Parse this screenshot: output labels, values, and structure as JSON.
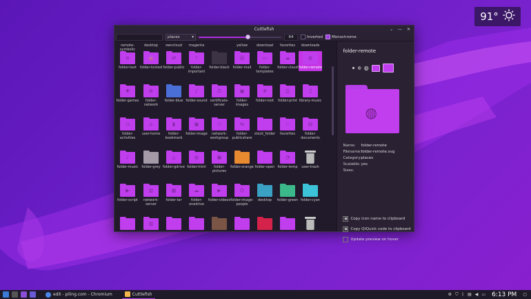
{
  "weather": {
    "temperature": "91°",
    "icon": "sun-icon"
  },
  "window": {
    "title": "Cuttlefish",
    "buttons": [
      "⌄",
      "—",
      "✕"
    ]
  },
  "toolbar": {
    "search_value": "",
    "category": "places",
    "size_value": "64",
    "size_fraction": 0.6,
    "inverted_label": "Inverted",
    "inverted_checked": false,
    "monochrome_label": "Monochrome",
    "monochrome_checked": true
  },
  "top_labels": [
    "remote-symbolic",
    "desktop",
    "owncloud",
    "magenta",
    "",
    "yellow",
    "download",
    "favorites",
    "downloads"
  ],
  "rows": [
    [
      {
        "label": "folder-text",
        "color": "#c03eee",
        "glyph": "≡"
      },
      {
        "label": "folder-locked",
        "color": "#c03eee",
        "glyph": "🔒"
      },
      {
        "label": "folder-public",
        "color": "#c03eee",
        "glyph": "⇄"
      },
      {
        "label": "folder-important",
        "color": "#c03eee",
        "glyph": "!"
      },
      {
        "label": "folder-black",
        "color": "#3c3444",
        "glyph": ""
      },
      {
        "label": "folder-mail",
        "color": "#c03eee",
        "glyph": "@"
      },
      {
        "label": "folder-templates",
        "color": "#c03eee",
        "glyph": "▭"
      },
      {
        "label": "folder-cloud",
        "color": "#c03eee",
        "glyph": "☁"
      },
      {
        "label": "folder-remote",
        "color": "#c03eee",
        "glyph": "◍",
        "selected": true
      }
    ],
    [
      {
        "label": "folder-games",
        "color": "#c03eee",
        "glyph": "✚"
      },
      {
        "label": "folder-network",
        "color": "#c03eee",
        "glyph": "⊞"
      },
      {
        "label": "folder-blue",
        "color": "#4a6fd6",
        "glyph": ""
      },
      {
        "label": "folder-sound",
        "color": "#c03eee",
        "glyph": "♪"
      },
      {
        "label": "certificate-server",
        "color": "#c03eee",
        "glyph": "⚿"
      },
      {
        "label": "folder-images",
        "color": "#c03eee",
        "glyph": "▣"
      },
      {
        "label": "folder-root",
        "color": "#c03eee",
        "glyph": "#"
      },
      {
        "label": "folder-print",
        "color": "#c03eee",
        "glyph": "⎙"
      },
      {
        "label": "library-music",
        "color": "#c03eee",
        "glyph": "♫"
      }
    ],
    [
      {
        "label": "folder-activities",
        "color": "#c03eee",
        "glyph": "◷"
      },
      {
        "label": "user-home",
        "color": "#c03eee",
        "glyph": "⌂"
      },
      {
        "label": "folder-bookmark",
        "color": "#c03eee",
        "glyph": "▮"
      },
      {
        "label": "folder-image",
        "color": "#c03eee",
        "glyph": "▣"
      },
      {
        "label": "network-workgroup",
        "color": "#c03eee",
        "glyph": "⚇"
      },
      {
        "label": "folder-publicshare",
        "color": "#c03eee",
        "glyph": "⇆"
      },
      {
        "label": "stock_folder",
        "color": "#c03eee",
        "glyph": ""
      },
      {
        "label": "favorites",
        "color": "#c03eee",
        "glyph": "☆"
      },
      {
        "label": "folder-documents",
        "color": "#c03eee",
        "glyph": "▤"
      }
    ],
    [
      {
        "label": "folder-music",
        "color": "#c03eee",
        "glyph": "♪"
      },
      {
        "label": "folder-grey",
        "color": "#a49aa8",
        "glyph": ""
      },
      {
        "label": "folder-gdrive",
        "color": "#c03eee",
        "glyph": "△"
      },
      {
        "label": "folder-html",
        "color": "#c03eee",
        "glyph": "◍"
      },
      {
        "label": "folder-pictures",
        "color": "#c03eee",
        "glyph": "▣"
      },
      {
        "label": "folder-orange",
        "color": "#e88a2f",
        "glyph": ""
      },
      {
        "label": "folder-open",
        "color": "#c03eee",
        "glyph": ""
      },
      {
        "label": "folder-temp",
        "color": "#c03eee",
        "glyph": "◔"
      },
      {
        "label": "user-trash",
        "color": "",
        "glyph": "",
        "trash": true
      }
    ],
    [
      {
        "label": "folder-script",
        "color": "#c03eee",
        "glyph": "▶"
      },
      {
        "label": "network-server",
        "color": "#c03eee",
        "glyph": "▥"
      },
      {
        "label": "folder-tar",
        "color": "#c03eee",
        "glyph": "▦"
      },
      {
        "label": "folder-onedrive",
        "color": "#c03eee",
        "glyph": "☁"
      },
      {
        "label": "folder-videos",
        "color": "#c03eee",
        "glyph": "▶"
      },
      {
        "label": "folder-image-people",
        "color": "#c03eee",
        "glyph": "☺"
      },
      {
        "label": "desktop",
        "color": "#3aa0c4",
        "glyph": ""
      },
      {
        "label": "folder-green",
        "color": "#3bb98a",
        "glyph": ""
      },
      {
        "label": "folder-cyan",
        "color": "#3cc3d8",
        "glyph": ""
      }
    ],
    [
      {
        "label": "",
        "color": "#c03eee",
        "glyph": ""
      },
      {
        "label": "",
        "color": "#c03eee",
        "glyph": "▥"
      },
      {
        "label": "",
        "color": "#c03eee",
        "glyph": ""
      },
      {
        "label": "",
        "color": "#c03eee",
        "glyph": ""
      },
      {
        "label": "",
        "color": "#7a5444",
        "glyph": ""
      },
      {
        "label": "",
        "color": "#c03eee",
        "glyph": ""
      },
      {
        "label": "",
        "color": "#d4224a",
        "glyph": ""
      },
      {
        "label": "",
        "color": "#c03eee",
        "glyph": ""
      },
      {
        "label": "",
        "color": "",
        "glyph": "",
        "trash": true
      }
    ]
  ],
  "details": {
    "name": "folder-remote",
    "fields": [
      {
        "k": "Name:",
        "v": "folder-remote"
      },
      {
        "k": "Filename:",
        "v": "folder-remote.svg"
      },
      {
        "k": "Category:",
        "v": "places"
      },
      {
        "k": "Scalable:",
        "v": "yes"
      },
      {
        "k": "Sizes:",
        "v": ""
      }
    ],
    "copy_name": "Copy icon name to clipboard",
    "copy_qtquick": "Copy QtQuick code to clipboard",
    "update_preview": "Update preview on hover"
  },
  "taskbar": {
    "tasks": [
      {
        "label": "edit - piling.com - Chromium",
        "active": false
      },
      {
        "label": "Cuttlefish",
        "active": true
      }
    ],
    "clock": "6:13 PM"
  }
}
